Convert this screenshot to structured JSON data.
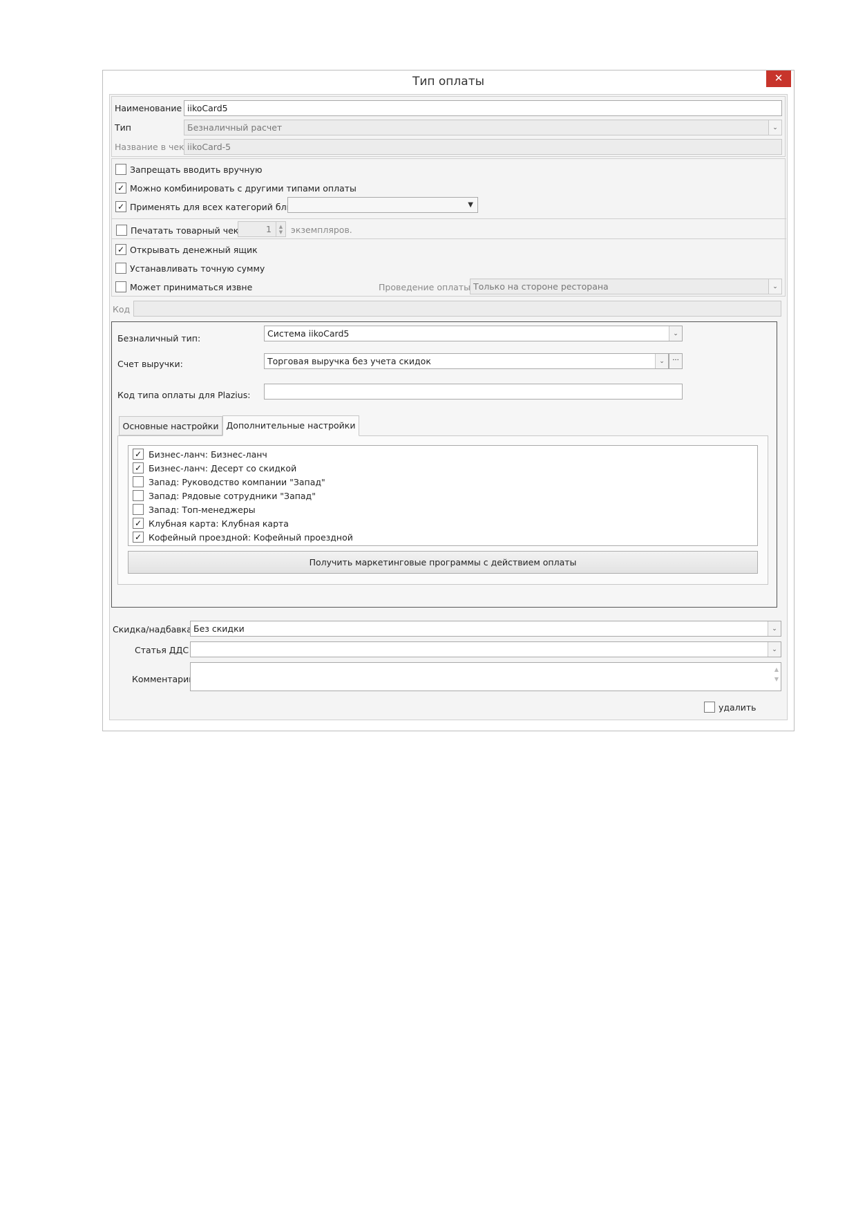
{
  "window": {
    "title": "Тип оплаты",
    "close_glyph": "✕"
  },
  "fields": {
    "name": {
      "label": "Наименование",
      "value": "iikoCard5"
    },
    "type": {
      "label": "Тип",
      "value": "Безналичный расчет"
    },
    "receipt_name": {
      "label": "Название в чеке",
      "value": "iikoCard-5"
    }
  },
  "options": {
    "forbid_manual": {
      "label": "Запрещать вводить вручную",
      "checked": false
    },
    "combine": {
      "label": "Можно комбинировать с другими типами оплаты",
      "checked": true
    },
    "all_categories": {
      "label": "Применять для всех категорий блюд",
      "checked": true,
      "dropdown_value": ""
    },
    "print_receipt": {
      "label": "Печатать товарный чек,",
      "checked": false,
      "copies": "1",
      "copies_suffix": "экземпляров."
    },
    "open_drawer": {
      "label": "Открывать денежный ящик",
      "checked": true
    },
    "exact_sum": {
      "label": "Устанавливать точную сумму",
      "checked": false
    },
    "external": {
      "label": "Может приниматься извне",
      "checked": false
    },
    "processing": {
      "label": "Проведение оплаты:",
      "value": "Только на стороне ресторана"
    }
  },
  "code": {
    "label": "Код",
    "value": ""
  },
  "cashless": {
    "type": {
      "label": "Безналичный тип:",
      "value": "Система iikoCard5"
    },
    "revenue_account": {
      "label": "Счет выручки:",
      "value": "Торговая выручка без учета скидок"
    },
    "plazius_code": {
      "label": "Код типа оплаты для Plazius:",
      "value": ""
    }
  },
  "tabs": [
    {
      "label": "Основные настройки"
    },
    {
      "label": "Дополнительные настройки"
    }
  ],
  "programs": [
    {
      "label": "Бизнес-ланч: Бизнес-ланч",
      "checked": true
    },
    {
      "label": "Бизнес-ланч: Десерт со скидкой",
      "checked": true
    },
    {
      "label": "Запад: Руководство компании \"Запад\"",
      "checked": false
    },
    {
      "label": "Запад: Рядовые сотрудники \"Запад\"",
      "checked": false
    },
    {
      "label": "Запад: Топ-менеджеры",
      "checked": false
    },
    {
      "label": "Клубная карта: Клубная карта",
      "checked": true
    },
    {
      "label": "Кофейный проездной: Кофейный проездной",
      "checked": true
    }
  ],
  "get_programs_button": "Получить маркетинговые программы с действием оплаты",
  "bottom": {
    "discount": {
      "label": "Скидка/надбавка",
      "value": "Без скидки"
    },
    "dds": {
      "label": "Статья ДДС",
      "value": ""
    },
    "comment": {
      "label": "Комментарий",
      "value": ""
    },
    "delete": {
      "label": "удалить",
      "checked": false
    }
  },
  "glyphs": {
    "check": "✓",
    "dropdown": "▼",
    "chevron": "⌄",
    "ellipsis": "···",
    "spin_up": "▲",
    "spin_down": "▼"
  }
}
